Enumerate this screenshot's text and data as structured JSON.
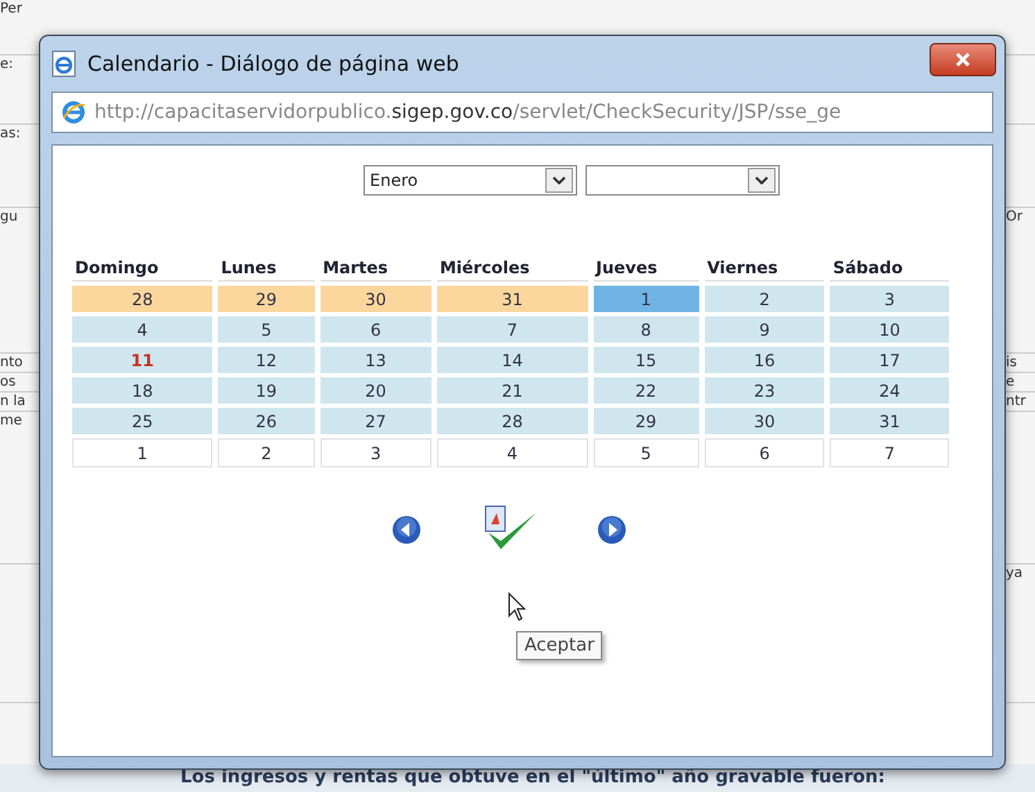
{
  "background": {
    "rows": [
      {
        "left": "Per",
        "right": ""
      },
      {
        "left": "e:",
        "right": ""
      },
      {
        "left": "as:",
        "right": ""
      },
      {
        "left": "gu",
        "right": "Or"
      },
      {
        "left": "nto",
        "right": "is"
      },
      {
        "left": "os",
        "right": "e"
      },
      {
        "left": "n la",
        "right": "ntr"
      },
      {
        "left": "me",
        "right": ""
      },
      {
        "left": "",
        "right": "ya"
      }
    ],
    "footer_text": "Los ingresos y rentas que obtuve en el \"último\" año gravable fueron:"
  },
  "dialog": {
    "title": "Calendario - Diálogo de página web",
    "address": {
      "prefix": "http://capacitaservidorpublico.",
      "domain": "sigep.gov.co",
      "path": "/servlet/CheckSecurity/JSP/sse_ge"
    },
    "month_select": {
      "value": "Enero"
    },
    "weekdays": [
      "Domingo",
      "Lunes",
      "Martes",
      "Miércoles",
      "Jueves",
      "Viernes",
      "Sábado"
    ],
    "weeks": [
      [
        {
          "day": "28",
          "kind": "prev",
          "selected": false,
          "highlight": false
        },
        {
          "day": "29",
          "kind": "prev",
          "selected": false,
          "highlight": false
        },
        {
          "day": "30",
          "kind": "prev",
          "selected": false,
          "highlight": false
        },
        {
          "day": "31",
          "kind": "prev",
          "selected": false,
          "highlight": false
        },
        {
          "day": "1",
          "kind": "current",
          "selected": true,
          "highlight": false
        },
        {
          "day": "2",
          "kind": "current",
          "selected": false,
          "highlight": false
        },
        {
          "day": "3",
          "kind": "current",
          "selected": false,
          "highlight": false
        }
      ],
      [
        {
          "day": "4",
          "kind": "current",
          "selected": false,
          "highlight": false
        },
        {
          "day": "5",
          "kind": "current",
          "selected": false,
          "highlight": false
        },
        {
          "day": "6",
          "kind": "current",
          "selected": false,
          "highlight": false
        },
        {
          "day": "7",
          "kind": "current",
          "selected": false,
          "highlight": false
        },
        {
          "day": "8",
          "kind": "current",
          "selected": false,
          "highlight": false
        },
        {
          "day": "9",
          "kind": "current",
          "selected": false,
          "highlight": false
        },
        {
          "day": "10",
          "kind": "current",
          "selected": false,
          "highlight": false
        }
      ],
      [
        {
          "day": "11",
          "kind": "current",
          "selected": false,
          "highlight": true
        },
        {
          "day": "12",
          "kind": "current",
          "selected": false,
          "highlight": false
        },
        {
          "day": "13",
          "kind": "current",
          "selected": false,
          "highlight": false
        },
        {
          "day": "14",
          "kind": "current",
          "selected": false,
          "highlight": false
        },
        {
          "day": "15",
          "kind": "current",
          "selected": false,
          "highlight": false
        },
        {
          "day": "16",
          "kind": "current",
          "selected": false,
          "highlight": false
        },
        {
          "day": "17",
          "kind": "current",
          "selected": false,
          "highlight": false
        }
      ],
      [
        {
          "day": "18",
          "kind": "current",
          "selected": false,
          "highlight": false
        },
        {
          "day": "19",
          "kind": "current",
          "selected": false,
          "highlight": false
        },
        {
          "day": "20",
          "kind": "current",
          "selected": false,
          "highlight": false
        },
        {
          "day": "21",
          "kind": "current",
          "selected": false,
          "highlight": false
        },
        {
          "day": "22",
          "kind": "current",
          "selected": false,
          "highlight": false
        },
        {
          "day": "23",
          "kind": "current",
          "selected": false,
          "highlight": false
        },
        {
          "day": "24",
          "kind": "current",
          "selected": false,
          "highlight": false
        }
      ],
      [
        {
          "day": "25",
          "kind": "current",
          "selected": false,
          "highlight": false
        },
        {
          "day": "26",
          "kind": "current",
          "selected": false,
          "highlight": false
        },
        {
          "day": "27",
          "kind": "current",
          "selected": false,
          "highlight": false
        },
        {
          "day": "28",
          "kind": "current",
          "selected": false,
          "highlight": false
        },
        {
          "day": "29",
          "kind": "current",
          "selected": false,
          "highlight": false
        },
        {
          "day": "30",
          "kind": "current",
          "selected": false,
          "highlight": false
        },
        {
          "day": "31",
          "kind": "current",
          "selected": false,
          "highlight": false
        }
      ],
      [
        {
          "day": "1",
          "kind": "next",
          "selected": false,
          "highlight": false
        },
        {
          "day": "2",
          "kind": "next",
          "selected": false,
          "highlight": false
        },
        {
          "day": "3",
          "kind": "next",
          "selected": false,
          "highlight": false
        },
        {
          "day": "4",
          "kind": "next",
          "selected": false,
          "highlight": false
        },
        {
          "day": "5",
          "kind": "next",
          "selected": false,
          "highlight": false
        },
        {
          "day": "6",
          "kind": "next",
          "selected": false,
          "highlight": false
        },
        {
          "day": "7",
          "kind": "next",
          "selected": false,
          "highlight": false
        }
      ]
    ],
    "tooltip": "Aceptar"
  }
}
